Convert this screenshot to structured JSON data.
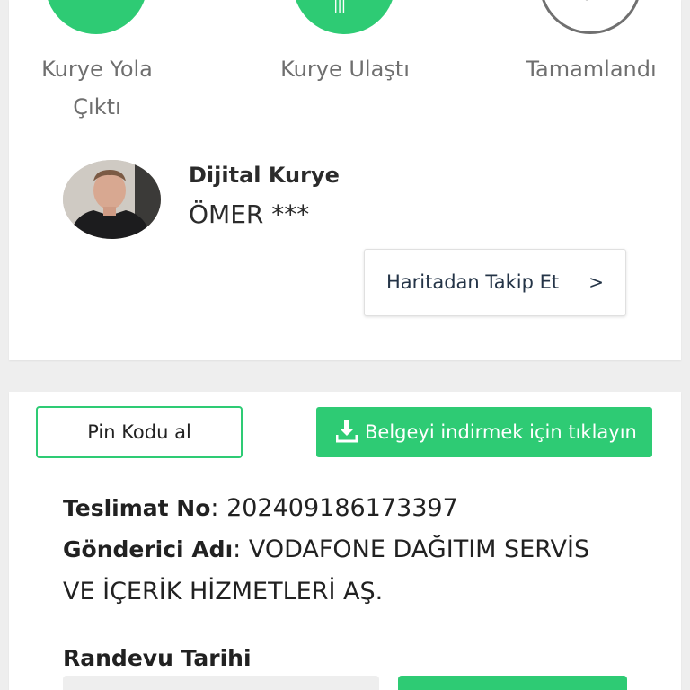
{
  "status_steps": [
    {
      "label_line1": "Kurye Yola",
      "label_line2": "Çıktı",
      "state": "done"
    },
    {
      "label_line1": "Kurye Ulaştı",
      "label_line2": "",
      "state": "done"
    },
    {
      "label_line1": "Tamamlandı",
      "label_line2": "",
      "state": "pending"
    }
  ],
  "colors": {
    "accent": "#2ecb74",
    "text_muted": "#6f6f6f",
    "background": "#eeeeee"
  },
  "courier": {
    "title": "Dijital Kurye",
    "name": "ÖMER ***",
    "track_label": "Haritadan Takip Et",
    "track_chevron": ">"
  },
  "actions": {
    "pin_label": "Pin Kodu al",
    "download_label": "Belgeyi indirmek için tıklayın",
    "download_icon": "download-icon"
  },
  "delivery": {
    "no_label": "Teslimat No",
    "no_value": "202409186173397",
    "sender_label": "Gönderici Adı",
    "sender_value_line1": "VODAFONE DAĞITIM SERVİS",
    "sender_value_line2": "VE İÇERİK HİZMETLERİ AŞ.",
    "separator": ": "
  },
  "appointment": {
    "label": "Randevu Tarihi"
  }
}
